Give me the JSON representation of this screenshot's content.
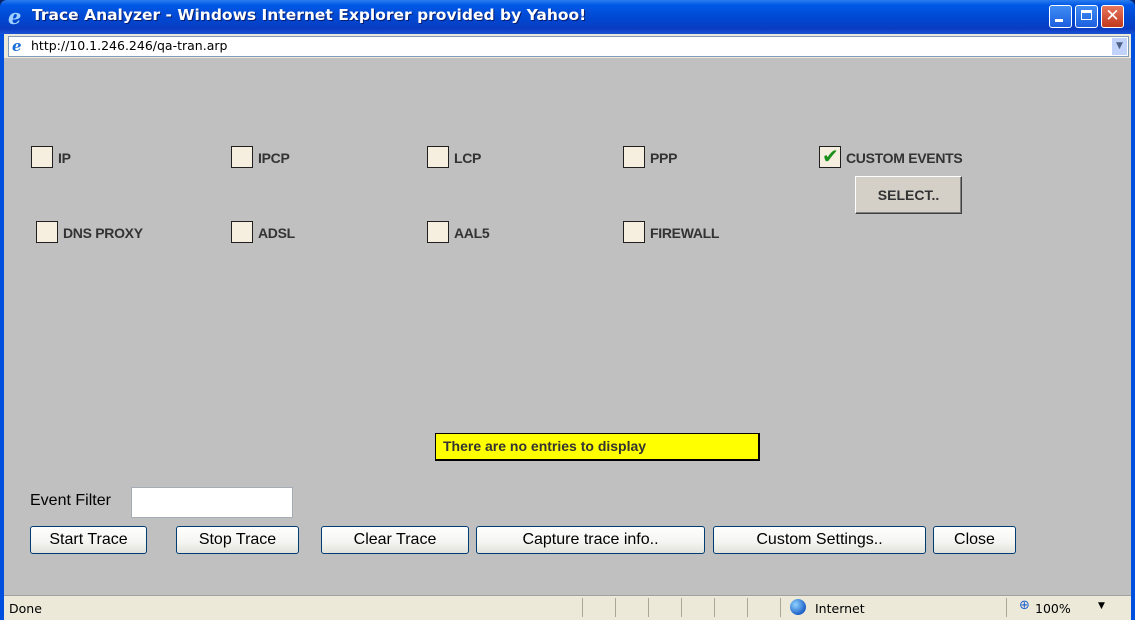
{
  "window": {
    "title": "Trace Analyzer - Windows Internet Explorer provided by Yahoo!",
    "icon": "ie-icon",
    "controls": {
      "minimize": "minimize-icon",
      "maximize": "maximize-icon",
      "close": "close-icon",
      "close_glyph": "✕"
    }
  },
  "address": {
    "url": "http://10.1.246.246/qa-tran.arp",
    "icon": "ie-page-icon",
    "dropdown_glyph": "▼"
  },
  "checkboxes": [
    {
      "label": "IP",
      "checked": false
    },
    {
      "label": "IPCP",
      "checked": false
    },
    {
      "label": "LCP",
      "checked": false
    },
    {
      "label": "PPP",
      "checked": false
    },
    {
      "label": "CUSTOM EVENTS",
      "checked": true
    },
    {
      "label": "DNS PROXY",
      "checked": false
    },
    {
      "label": "ADSL",
      "checked": false
    },
    {
      "label": "AAL5",
      "checked": false
    },
    {
      "label": "FIREWALL",
      "checked": false
    }
  ],
  "check_glyph": "✔",
  "select_button": "SELECT..",
  "empty_message": "There are no entries to display",
  "event_filter": {
    "label": "Event Filter",
    "value": ""
  },
  "buttons": {
    "start_trace": "Start Trace",
    "stop_trace": "Stop Trace",
    "clear_trace": "Clear Trace",
    "capture_trace_info": "Capture trace info..",
    "custom_settings": "Custom Settings..",
    "close": "Close"
  },
  "status": {
    "text": "Done",
    "zone": "Internet",
    "zone_icon": "globe-icon",
    "zoom": "100%",
    "zoom_icon": "zoom-icon",
    "zoom_glyph": "⊕",
    "zoom_dropdown_glyph": "▼"
  },
  "colors": {
    "title_bar": "#0054e3",
    "content_background": "#c0c0c0",
    "message_background": "#ffff00",
    "check_mark": "#1b8f1b"
  }
}
